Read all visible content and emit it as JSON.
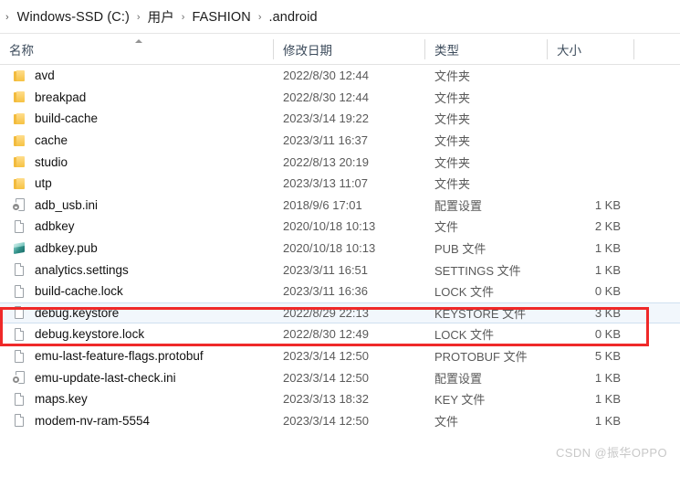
{
  "breadcrumb": {
    "lead_chevron": "›",
    "separator": "›",
    "items": [
      {
        "label": "Windows-SSD (C:)"
      },
      {
        "label": "用户"
      },
      {
        "label": "FASHION"
      },
      {
        "label": ".android"
      }
    ]
  },
  "columns": {
    "name": "名称",
    "date_modified": "修改日期",
    "type": "类型",
    "size": "大小",
    "sort_indicator": "ascending"
  },
  "rows": [
    {
      "name": "avd",
      "date": "2022/8/30 12:44",
      "type": "文件夹",
      "size": "",
      "icon": "folder-icon",
      "selected": false
    },
    {
      "name": "breakpad",
      "date": "2022/8/30 12:44",
      "type": "文件夹",
      "size": "",
      "icon": "folder-icon",
      "selected": false
    },
    {
      "name": "build-cache",
      "date": "2023/3/14 19:22",
      "type": "文件夹",
      "size": "",
      "icon": "folder-icon",
      "selected": false
    },
    {
      "name": "cache",
      "date": "2023/3/11 16:37",
      "type": "文件夹",
      "size": "",
      "icon": "folder-icon",
      "selected": false
    },
    {
      "name": "studio",
      "date": "2022/8/13 20:19",
      "type": "文件夹",
      "size": "",
      "icon": "folder-icon",
      "selected": false
    },
    {
      "name": "utp",
      "date": "2023/3/13 11:07",
      "type": "文件夹",
      "size": "",
      "icon": "folder-icon",
      "selected": false
    },
    {
      "name": "adb_usb.ini",
      "date": "2018/9/6 17:01",
      "type": "配置设置",
      "size": "1 KB",
      "icon": "ini-file-icon",
      "selected": false
    },
    {
      "name": "adbkey",
      "date": "2020/10/18 10:13",
      "type": "文件",
      "size": "2 KB",
      "icon": "file-icon",
      "selected": false
    },
    {
      "name": "adbkey.pub",
      "date": "2020/10/18 10:13",
      "type": "PUB 文件",
      "size": "1 KB",
      "icon": "pub-file-icon",
      "selected": false
    },
    {
      "name": "analytics.settings",
      "date": "2023/3/11 16:51",
      "type": "SETTINGS 文件",
      "size": "1 KB",
      "icon": "file-icon",
      "selected": false
    },
    {
      "name": "build-cache.lock",
      "date": "2023/3/11 16:36",
      "type": "LOCK 文件",
      "size": "0 KB",
      "icon": "file-icon",
      "selected": false
    },
    {
      "name": "debug.keystore",
      "date": "2022/8/29 22:13",
      "type": "KEYSTORE 文件",
      "size": "3 KB",
      "icon": "file-icon",
      "selected": true
    },
    {
      "name": "debug.keystore.lock",
      "date": "2022/8/30 12:49",
      "type": "LOCK 文件",
      "size": "0 KB",
      "icon": "file-icon",
      "selected": false
    },
    {
      "name": "emu-last-feature-flags.protobuf",
      "date": "2023/3/14 12:50",
      "type": "PROTOBUF 文件",
      "size": "5 KB",
      "icon": "file-icon",
      "selected": false
    },
    {
      "name": "emu-update-last-check.ini",
      "date": "2023/3/14 12:50",
      "type": "配置设置",
      "size": "1 KB",
      "icon": "ini-file-icon",
      "selected": false
    },
    {
      "name": "maps.key",
      "date": "2023/3/13 18:32",
      "type": "KEY 文件",
      "size": "1 KB",
      "icon": "file-icon",
      "selected": false
    },
    {
      "name": "modem-nv-ram-5554",
      "date": "2023/3/14 12:50",
      "type": "文件",
      "size": "1 KB",
      "icon": "file-icon",
      "selected": false
    }
  ],
  "annotation": {
    "color": "#ef2929",
    "highlights": [
      "debug.keystore",
      "debug.keystore.lock"
    ]
  },
  "watermark": {
    "text": "CSDN @振华OPPO"
  }
}
